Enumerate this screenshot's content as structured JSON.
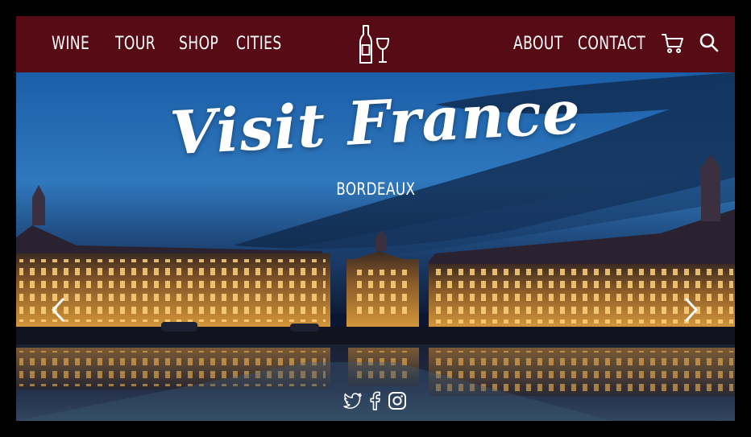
{
  "nav": {
    "left_items": [
      {
        "label": "WINE"
      },
      {
        "label": "TOUR"
      },
      {
        "label": "SHOP"
      },
      {
        "label": "CITIES"
      }
    ],
    "right_items": [
      {
        "label": "ABOUT"
      },
      {
        "label": "CONTACT"
      }
    ],
    "icons": {
      "logo": "wine-bottle-glass-icon",
      "cart": "cart-icon",
      "search": "search-icon"
    }
  },
  "hero": {
    "title": "Visit France",
    "subtitle": "BORDEAUX",
    "prev_icon": "chevron-left-icon",
    "next_icon": "chevron-right-icon"
  },
  "social": {
    "icons": [
      "twitter-icon",
      "facebook-icon",
      "instagram-icon"
    ]
  },
  "colors": {
    "nav_bg": "#560b15",
    "text": "#ffffff"
  }
}
